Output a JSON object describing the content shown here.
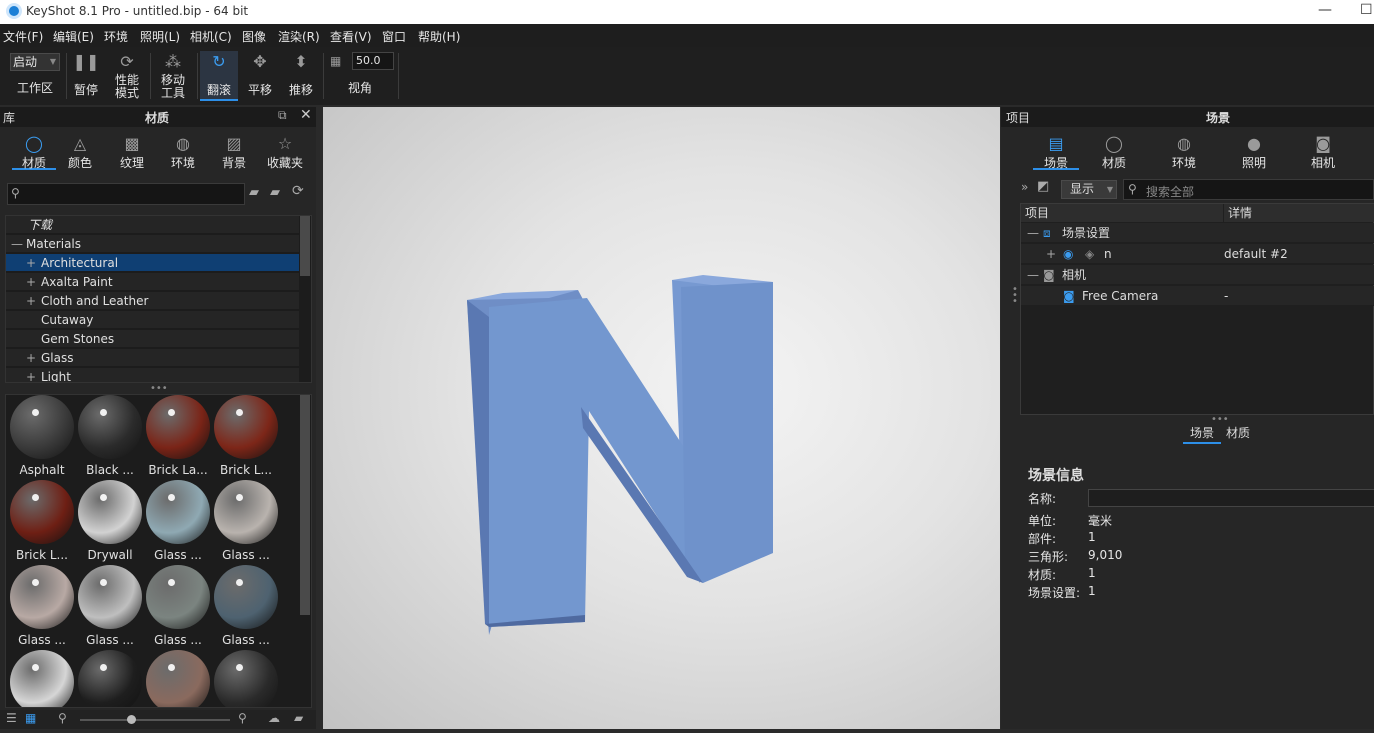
{
  "window": {
    "title": "KeyShot 8.1 Pro  - untitled.bip  - 64 bit",
    "minimize": "—",
    "maximize": "☐"
  },
  "menu": [
    "文件(F)",
    "编辑(E)",
    "环境",
    "照明(L)",
    "相机(C)",
    "图像",
    "渲染(R)",
    "查看(V)",
    "窗口",
    "帮助(H)"
  ],
  "toolbar": {
    "workspace_value": "启动",
    "workspace_label": "工作区",
    "pause": "暂停",
    "perf": [
      "性能",
      "模式"
    ],
    "move": [
      "移动",
      "工具"
    ],
    "tumble": "翻滚",
    "pan": "平移",
    "dolly": "推移",
    "fov_value": "50.0",
    "fov_label": "视角"
  },
  "library": {
    "title_left": "库",
    "title": "材质",
    "tabs": [
      "材质",
      "颜色",
      "纹理",
      "环境",
      "背景",
      "收藏夹"
    ],
    "tree": [
      {
        "label": "下载",
        "pm": "",
        "indent": 1,
        "italic": true
      },
      {
        "label": "Materials",
        "pm": "—",
        "indent": 0
      },
      {
        "label": "Architectural",
        "pm": "+",
        "indent": 2,
        "selected": true
      },
      {
        "label": "Axalta Paint",
        "pm": "+",
        "indent": 2
      },
      {
        "label": "Cloth and Leather",
        "pm": "+",
        "indent": 2
      },
      {
        "label": "Cutaway",
        "pm": "",
        "indent": 2
      },
      {
        "label": "Gem Stones",
        "pm": "",
        "indent": 2
      },
      {
        "label": "Glass",
        "pm": "+",
        "indent": 2
      },
      {
        "label": "Light",
        "pm": "+",
        "indent": 2
      }
    ],
    "thumbs": [
      {
        "label": "Asphalt",
        "color": "#3a3a3a"
      },
      {
        "label": "Black ...",
        "color": "#2b2b2b"
      },
      {
        "label": "Brick La...",
        "color": "#7a2417"
      },
      {
        "label": "Brick L...",
        "color": "#7d2618"
      },
      {
        "label": "Brick L...",
        "color": "#6e1f14"
      },
      {
        "label": "Drywall",
        "color": "#d2d2d2"
      },
      {
        "label": "Glass ...",
        "color": "#8fa9b3"
      },
      {
        "label": "Glass ...",
        "color": "#b9b3ae"
      },
      {
        "label": "Glass ...",
        "color": "#b8a9a4"
      },
      {
        "label": "Glass ...",
        "color": "#bfbfbf"
      },
      {
        "label": "Glass ...",
        "color": "#7b8480"
      },
      {
        "label": "Glass ...",
        "color": "#4e6270"
      },
      {
        "label": "",
        "color": "#d6d6d6"
      },
      {
        "label": "",
        "color": "#1e1e1e"
      },
      {
        "label": "",
        "color": "#8a6a5e"
      },
      {
        "label": "",
        "color": "#2a2a2a"
      }
    ]
  },
  "project": {
    "title_left": "项目",
    "title": "场景",
    "tabs": [
      "场景",
      "材质",
      "环境",
      "照明",
      "相机"
    ],
    "display": "显示",
    "search_placeholder": "搜索全部",
    "col_item": "项目",
    "col_detail": "详情",
    "rows": [
      {
        "pm": "—",
        "label": "场景设置",
        "detail": ""
      },
      {
        "pm": "+",
        "label": "n",
        "detail": "default  #2"
      },
      {
        "pm": "—",
        "label": "相机",
        "detail": ""
      },
      {
        "pm": "",
        "label": "Free Camera",
        "detail": "-"
      }
    ],
    "subtabs": [
      "场景",
      "材质"
    ],
    "info_title": "场景信息",
    "info": [
      {
        "k": "名称:",
        "v": ""
      },
      {
        "k": "单位:",
        "v": "毫米"
      },
      {
        "k": "部件:",
        "v": "1"
      },
      {
        "k": "三角形:",
        "v": "9,010"
      },
      {
        "k": "材质:",
        "v": "1"
      },
      {
        "k": "场景设置:",
        "v": "1"
      }
    ]
  },
  "colors": {
    "accent": "#2d8fe8",
    "model": "#7397cf"
  }
}
